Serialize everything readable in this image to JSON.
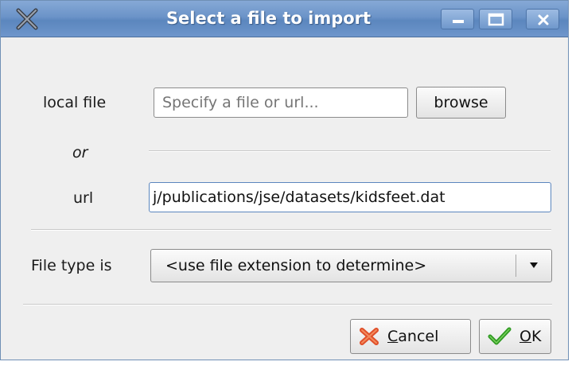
{
  "window": {
    "title": "Select a file to import"
  },
  "local_file": {
    "label": "local file",
    "placeholder": "Specify a file or url...",
    "browse_label": "browse"
  },
  "or_label": "or",
  "url": {
    "label": "url",
    "value": "j/publications/jse/datasets/kidsfeet.dat"
  },
  "file_type": {
    "label": "File type is",
    "selected": "<use file extension to determine>"
  },
  "buttons": {
    "cancel_mnemonic": "C",
    "cancel_rest": "ancel",
    "ok_mnemonic": "O",
    "ok_rest": "K"
  },
  "colors": {
    "titlebar": "#6b93c8",
    "cancel_icon": "#e0502a",
    "ok_icon": "#3cab2a"
  }
}
